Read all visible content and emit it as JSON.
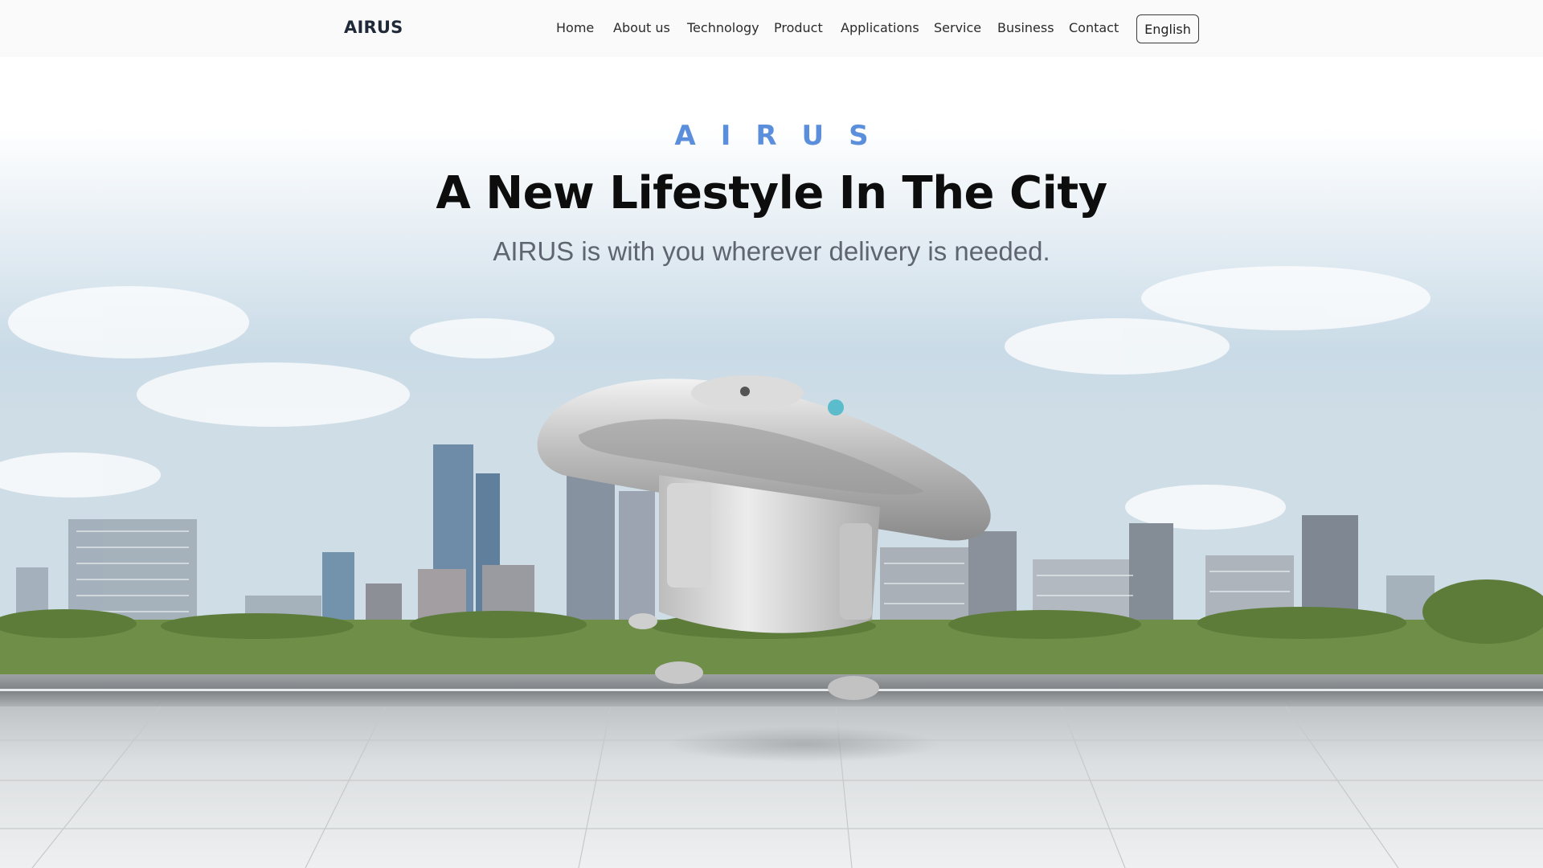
{
  "nav": {
    "logo": "AIRUS",
    "links": [
      "Home",
      "About us",
      "Technology",
      "Product",
      "Applications",
      "Service",
      "Business",
      "Contact"
    ],
    "language_button": "English"
  },
  "hero": {
    "eyebrow": "AIRUS",
    "headline": "A New Lifestyle In The City",
    "subline": "AIRUS is with you wherever delivery is needed."
  },
  "colors": {
    "accent": "#5b8fdb",
    "nav_bg": "#fafafa",
    "headline": "#0d0d0d",
    "subline": "#5f6570"
  }
}
